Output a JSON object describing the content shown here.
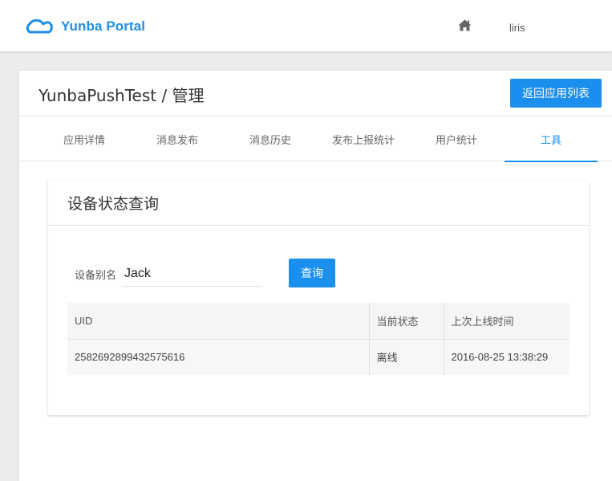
{
  "header": {
    "brand": "Yunba Portal",
    "brand_icon": "cloud-icon",
    "home_icon": "home-icon",
    "user": "liris",
    "accent_color": "#1a8fee"
  },
  "page": {
    "title": "YunbaPushTest / 管理",
    "back_button": "返回应用列表"
  },
  "tabs": [
    {
      "label": "应用详情",
      "active": false
    },
    {
      "label": "消息发布",
      "active": false
    },
    {
      "label": "消息历史",
      "active": false
    },
    {
      "label": "发布上报统计",
      "active": false
    },
    {
      "label": "用户统计",
      "active": false
    },
    {
      "label": "工具",
      "active": true
    }
  ],
  "panel": {
    "title": "设备状态查询",
    "alias_label": "设备别名",
    "alias_value": "Jack",
    "query_button": "查询",
    "columns": [
      "UID",
      "当前状态",
      "上次上线时间"
    ],
    "rows": [
      [
        "2582692899432575616",
        "离线",
        "2016-08-25 13:38:29"
      ]
    ]
  }
}
